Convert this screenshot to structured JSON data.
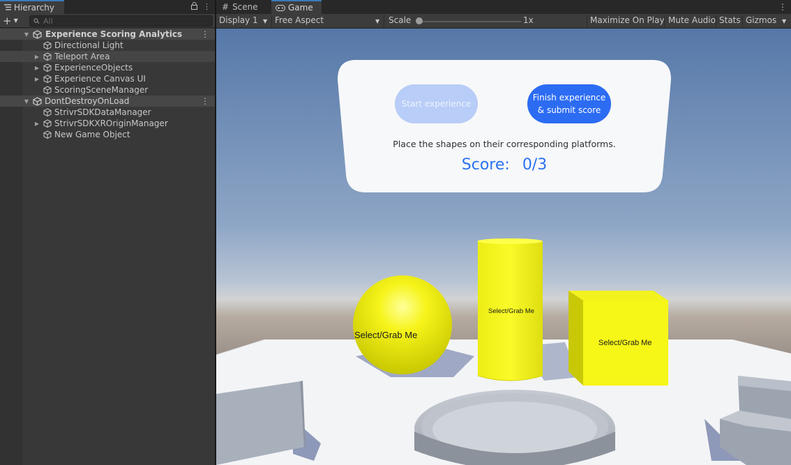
{
  "hierarchy": {
    "tab_title": "Hierarchy",
    "search_placeholder": "All",
    "rows": [
      {
        "label": "Experience Scoring Analytics"
      },
      {
        "label": "Directional Light"
      },
      {
        "label": "Teleport Area"
      },
      {
        "label": "ExperienceObjects"
      },
      {
        "label": "Experience Canvas UI"
      },
      {
        "label": "ScoringSceneManager"
      },
      {
        "label": "DontDestroyOnLoad"
      },
      {
        "label": "StrivrSDKDataManager"
      },
      {
        "label": "StrivrSDKXROriginManager"
      },
      {
        "label": "New Game Object"
      }
    ]
  },
  "game": {
    "tabs": [
      {
        "label": "Scene",
        "icon": "hash-grid-icon"
      },
      {
        "label": "Game",
        "icon": "gamepad-icon"
      }
    ],
    "toolbar": {
      "display": "Display 1",
      "aspect": "Free Aspect",
      "scale_label": "Scale",
      "scale_value": "1x",
      "maximize": "Maximize On Play",
      "mute": "Mute Audio",
      "stats": "Stats",
      "gizmos": "Gizmos"
    },
    "ui": {
      "start_button": "Start experience",
      "finish_button": "Finish experience\n& submit score",
      "instructions": "Place the shapes on their corresponding platforms.",
      "score_label": "Score:",
      "score_value": "0/3"
    },
    "objects": {
      "sphere_label": "Select/Grab Me",
      "cylinder_label": "Select/Grab Me",
      "cube_label": "Select/Grab Me"
    }
  }
}
